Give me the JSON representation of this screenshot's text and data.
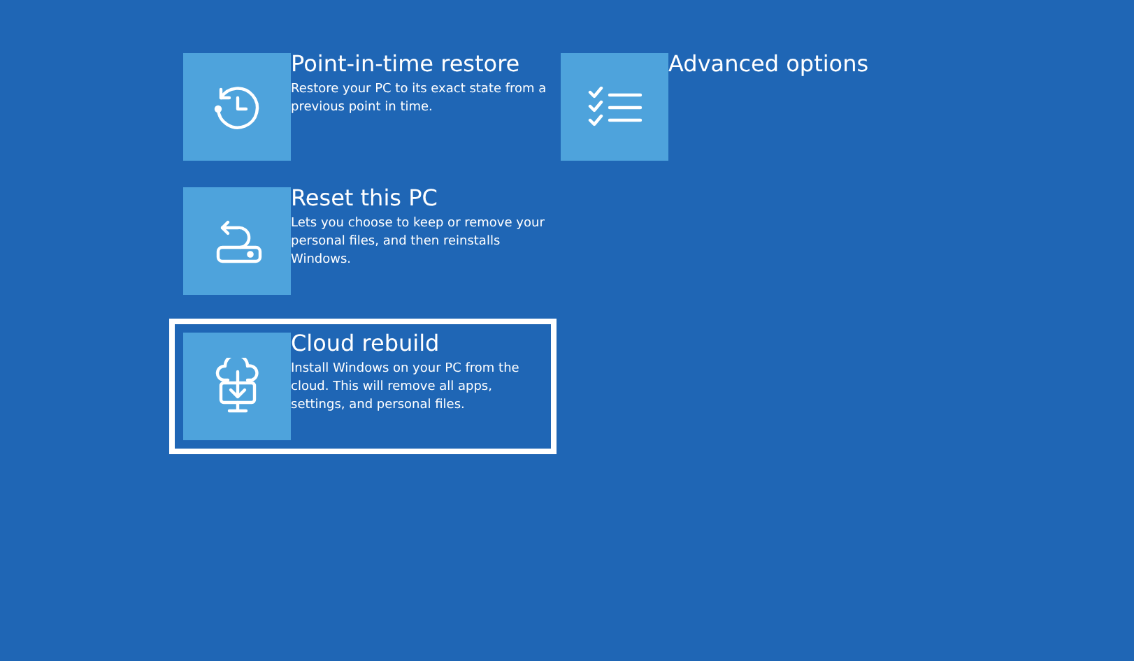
{
  "columns": [
    [
      {
        "kind": "restore",
        "title": "Point-in-time restore",
        "description": "Restore your PC to its exact state from a previous point in time.",
        "selected": false
      },
      {
        "kind": "reset",
        "title": "Reset this PC",
        "description": "Lets you choose to keep or remove your personal files, and then reinstalls Windows.",
        "selected": false
      },
      {
        "kind": "cloud",
        "title": "Cloud rebuild",
        "description": "Install Windows on your PC from the cloud. This will remove all apps, settings, and personal files.",
        "selected": true
      }
    ],
    [
      {
        "kind": "advanced",
        "title": "Advanced options",
        "selected": false
      }
    ]
  ]
}
